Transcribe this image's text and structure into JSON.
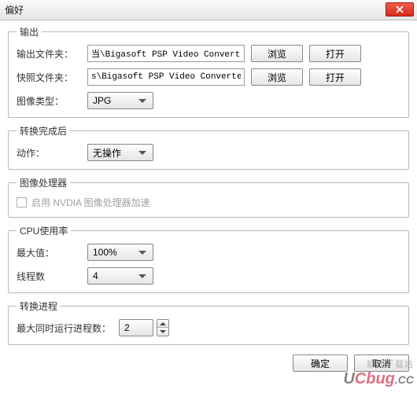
{
  "title": "偏好",
  "output": {
    "legend": "输出",
    "folder_label": "输出文件夹：",
    "folder_value": "当\\Bigasoft PSP Video Converter",
    "snapshot_label": "快照文件夹：",
    "snapshot_value": "s\\Bigasoft PSP Video Converter",
    "browse": "浏览",
    "open": "打开",
    "image_type_label": "图像类型：",
    "image_type_value": "JPG"
  },
  "after": {
    "legend": "转换完成后",
    "action_label": "动作：",
    "action_value": "无操作"
  },
  "gpu": {
    "legend": "图像处理器",
    "checkbox_label": "启用 NVDIA 图像处理器加速"
  },
  "cpu": {
    "legend": "CPU使用率",
    "max_label": "最大值：",
    "max_value": "100%",
    "threads_label": "线程数",
    "threads_value": "4"
  },
  "process": {
    "legend": "转换进程",
    "concurrent_label": "最大同时运行进程数：",
    "concurrent_value": "2"
  },
  "buttons": {
    "ok": "确定",
    "cancel": "取消"
  },
  "watermark": {
    "top": "软件下载站",
    "main_u": "U",
    "main_rest": "Cbug",
    "cc": ".CC"
  }
}
